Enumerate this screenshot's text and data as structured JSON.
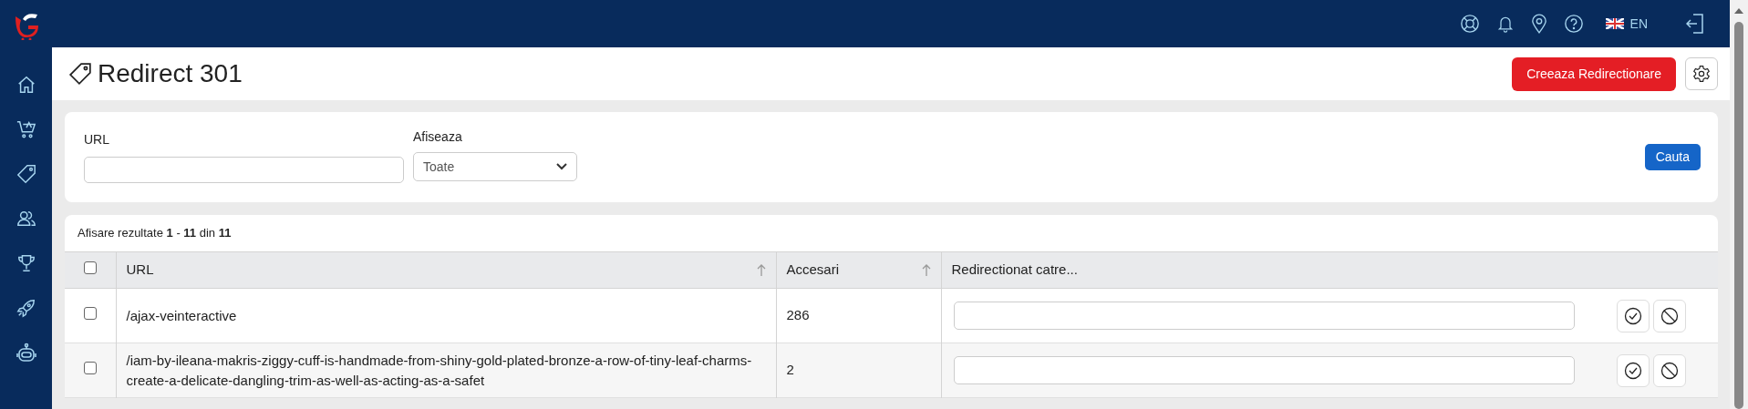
{
  "top_bar": {
    "language": "EN"
  },
  "header": {
    "title": "Redirect 301",
    "create_button": "Creeaza Redirectionare"
  },
  "filters": {
    "url_label": "URL",
    "show_label": "Afiseaza",
    "show_value": "Toate",
    "search_button": "Cauta"
  },
  "results": {
    "summary": "Afisare rezultate **1** - **11** din **11**"
  },
  "table": {
    "select_all_checked": false,
    "columns": [
      {
        "label": "URL",
        "sortable": true
      },
      {
        "label": "Accesari",
        "sortable": true
      },
      {
        "label": "Redirectionat catre...",
        "sortable": false
      }
    ],
    "rows": [
      {
        "checked": false,
        "url": "/ajax-veinteractive",
        "hits": "286"
      },
      {
        "checked": false,
        "url": "/iam-by-ileana-makris-ziggy-cuff-is-handmade-from-shiny-gold-plated-bronze-a-row-of-tiny-leaf-charms-create-a-delicate-dangling-trim-as-well-as-acting-as-a-safet",
        "hits": "2"
      }
    ]
  }
}
